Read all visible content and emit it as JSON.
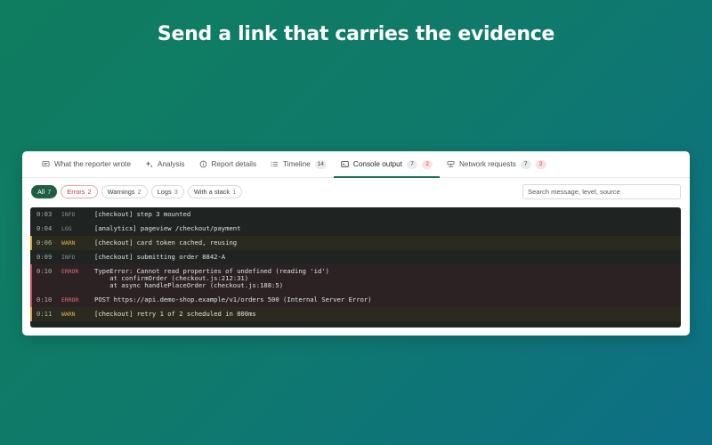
{
  "headline": "Send a link that carries the evidence",
  "tabs": [
    {
      "label": "What the reporter wrote",
      "icon": "message-icon"
    },
    {
      "label": "Analysis",
      "icon": "sparkle-icon"
    },
    {
      "label": "Report details",
      "icon": "info-icon"
    },
    {
      "label": "Timeline",
      "icon": "list-icon",
      "count": "14"
    },
    {
      "label": "Console output",
      "icon": "terminal-icon",
      "count": "7",
      "count2": "2",
      "active": true
    },
    {
      "label": "Network requests",
      "icon": "network-icon",
      "count": "7",
      "count2": "2"
    }
  ],
  "filters": [
    {
      "label": "All",
      "count": "7",
      "active": true
    },
    {
      "label": "Errors",
      "count": "2"
    },
    {
      "label": "Warnings",
      "count": "2"
    },
    {
      "label": "Logs",
      "count": "3"
    },
    {
      "label": "With a stack",
      "count": "1"
    }
  ],
  "search": {
    "placeholder": "Search message, level, source"
  },
  "logs": [
    {
      "time": "0:03",
      "level": "INFO",
      "message": "[checkout] step 3 mounted",
      "type": "info"
    },
    {
      "time": "0:04",
      "level": "LOG",
      "message": "[analytics] pageview /checkout/payment",
      "type": "log"
    },
    {
      "time": "0:06",
      "level": "WARN",
      "message": "[checkout] card token cached, reusing",
      "type": "warn"
    },
    {
      "time": "0:09",
      "level": "INFO",
      "message": "[checkout] submitting order 8842-A",
      "type": "info"
    },
    {
      "time": "0:10",
      "level": "ERROR",
      "message": "TypeError: Cannot read properties of undefined (reading 'id')\n    at confirmOrder (checkout.js:212:31)\n    at async handlePlaceOrder (checkout.js:188:5)",
      "type": "error"
    },
    {
      "time": "0:10",
      "level": "ERROR",
      "message": "POST https://api.demo-shop.example/v1/orders 500 (Internal Server Error)",
      "type": "error"
    },
    {
      "time": "0:11",
      "level": "WARN",
      "message": "[checkout] retry 1 of 2 scheduled in 800ms",
      "type": "warn"
    }
  ],
  "colors": {
    "accent": "#1f5d45",
    "error": "#c94a55",
    "warn": "#d9a23a"
  }
}
